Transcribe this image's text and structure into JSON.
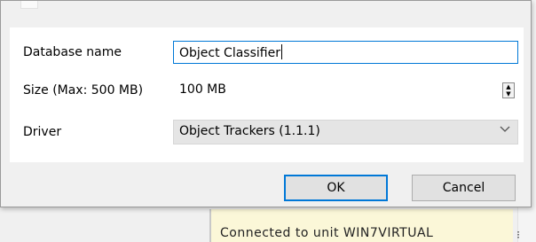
{
  "dialog": {
    "fields": {
      "database_name": {
        "label": "Database name",
        "value": "Object Classifier"
      },
      "size": {
        "label": "Size (Max: 500 MB)",
        "value": "100 MB"
      },
      "driver": {
        "label": "Driver",
        "value": "Object Trackers (1.1.1)"
      }
    },
    "buttons": {
      "ok": "OK",
      "cancel": "Cancel"
    }
  },
  "background": {
    "status_text": "Connected to unit WIN7VIRTUAL",
    "right_mark": "⁝"
  },
  "icons": {
    "spin_up": "spin-up-arrow",
    "spin_down": "spin-down-arrow",
    "dropdown": "chevron-down-icon"
  },
  "colors": {
    "focus": "#0078d7",
    "status_bg": "#fbf7d8"
  }
}
